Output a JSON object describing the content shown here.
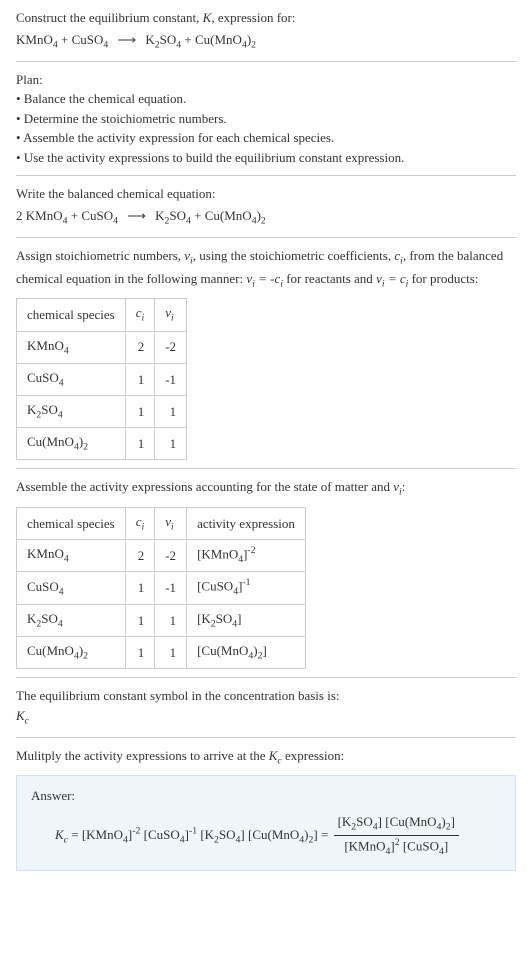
{
  "header": {
    "line1": "Construct the equilibrium constant, ",
    "k": "K",
    "line1b": ", expression for:",
    "reaction_lhs1": "KMnO",
    "reaction_lhs2": "CuSO",
    "reaction_rhs1": "K",
    "reaction_rhs1b": "SO",
    "reaction_rhs2": "Cu(MnO",
    "plus": " + ",
    "arrow": "⟶"
  },
  "plan": {
    "title": "Plan:",
    "items": [
      "• Balance the chemical equation.",
      "• Determine the stoichiometric numbers.",
      "• Assemble the activity expression for each chemical species.",
      "• Use the activity expressions to build the equilibrium constant expression."
    ]
  },
  "balanced": {
    "title": "Write the balanced chemical equation:",
    "coef1": "2 "
  },
  "stoich": {
    "text_a": "Assign stoichiometric numbers, ",
    "nu": "ν",
    "sub_i": "i",
    "text_b": ", using the stoichiometric coefficients, ",
    "c": "c",
    "text_c": ", from the balanced chemical equation in the following manner: ",
    "rel1_lhs": "ν",
    "rel1_eq": " = -",
    "rel1_rhs": "c",
    "rel1_tail": " for reactants and ",
    "rel2_lhs": "ν",
    "rel2_eq": " = ",
    "rel2_rhs": "c",
    "rel2_tail": " for products:"
  },
  "table1": {
    "headers": {
      "h1": "chemical species",
      "h2": "c",
      "h3": "ν"
    },
    "rows": [
      {
        "species": "KMnO4",
        "c": "2",
        "nu": "-2"
      },
      {
        "species": "CuSO4",
        "c": "1",
        "nu": "-1"
      },
      {
        "species": "K2SO4",
        "c": "1",
        "nu": "1"
      },
      {
        "species": "Cu(MnO4)2",
        "c": "1",
        "nu": "1"
      }
    ]
  },
  "activity": {
    "text": "Assemble the activity expressions accounting for the state of matter and ",
    "tail": ":"
  },
  "table2": {
    "headers": {
      "h1": "chemical species",
      "h2": "c",
      "h3": "ν",
      "h4": "activity expression"
    },
    "rows": [
      {
        "c": "2",
        "nu": "-2"
      },
      {
        "c": "1",
        "nu": "-1"
      },
      {
        "c": "1",
        "nu": "1"
      },
      {
        "c": "1",
        "nu": "1"
      }
    ]
  },
  "kc_symbol": {
    "text": "The equilibrium constant symbol in the concentration basis is:",
    "sym": "K",
    "sub": "c"
  },
  "multiply": {
    "text": "Mulitply the activity expressions to arrive at the ",
    "tail": " expression:"
  },
  "answer": {
    "label": "Answer:",
    "eq": " = "
  }
}
